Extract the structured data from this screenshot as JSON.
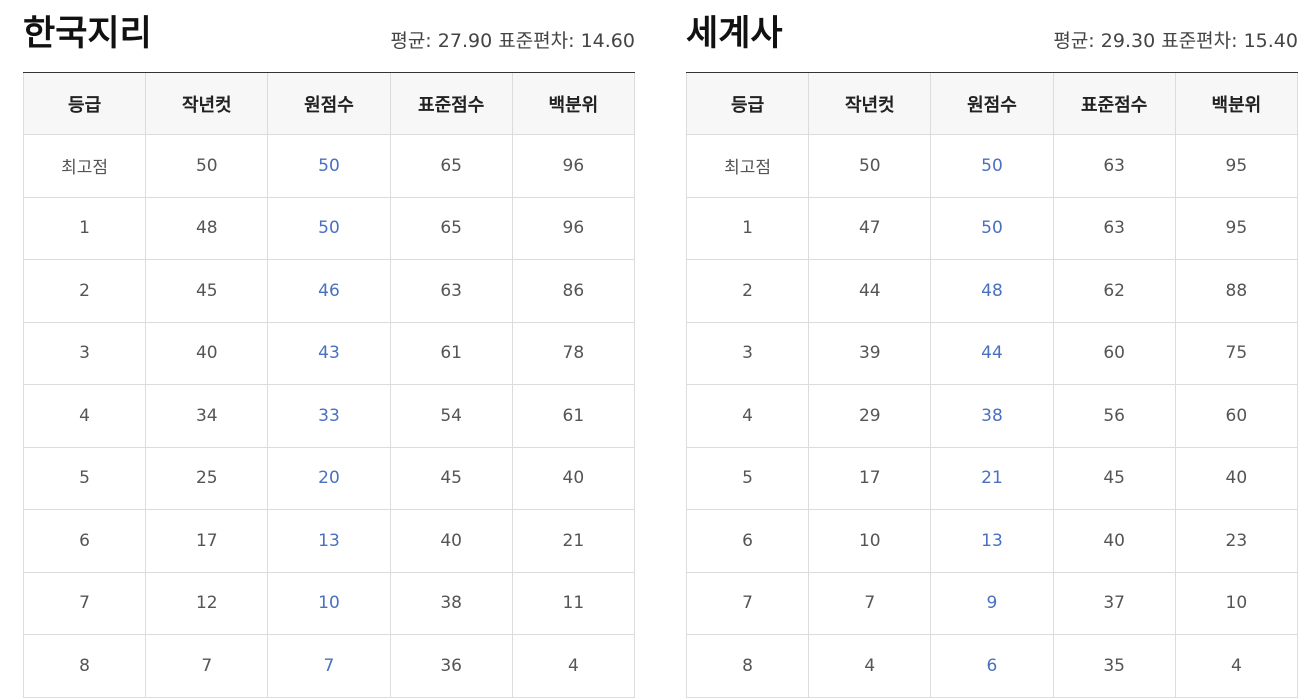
{
  "columns": [
    "등급",
    "작년컷",
    "원점수",
    "표준점수",
    "백분위"
  ],
  "stat_labels": {
    "mean": "평균:",
    "sd": "표준편차:"
  },
  "tables": [
    {
      "title": "한국지리",
      "mean": "27.90",
      "sd": "14.60",
      "rows": [
        [
          "최고점",
          "50",
          "50",
          "65",
          "96"
        ],
        [
          "1",
          "48",
          "50",
          "65",
          "96"
        ],
        [
          "2",
          "45",
          "46",
          "63",
          "86"
        ],
        [
          "3",
          "40",
          "43",
          "61",
          "78"
        ],
        [
          "4",
          "34",
          "33",
          "54",
          "61"
        ],
        [
          "5",
          "25",
          "20",
          "45",
          "40"
        ],
        [
          "6",
          "17",
          "13",
          "40",
          "21"
        ],
        [
          "7",
          "12",
          "10",
          "38",
          "11"
        ],
        [
          "8",
          "7",
          "7",
          "36",
          "4"
        ]
      ]
    },
    {
      "title": "세계사",
      "mean": "29.30",
      "sd": "15.40",
      "rows": [
        [
          "최고점",
          "50",
          "50",
          "63",
          "95"
        ],
        [
          "1",
          "47",
          "50",
          "63",
          "95"
        ],
        [
          "2",
          "44",
          "48",
          "62",
          "88"
        ],
        [
          "3",
          "39",
          "44",
          "60",
          "75"
        ],
        [
          "4",
          "29",
          "38",
          "56",
          "60"
        ],
        [
          "5",
          "17",
          "21",
          "45",
          "40"
        ],
        [
          "6",
          "10",
          "13",
          "40",
          "23"
        ],
        [
          "7",
          "7",
          "9",
          "37",
          "10"
        ],
        [
          "8",
          "4",
          "6",
          "35",
          "4"
        ]
      ]
    }
  ],
  "colors": {
    "raw_score": "#4a70c0",
    "header_bg": "#f7f7f7",
    "border": "#dcdcdc"
  }
}
